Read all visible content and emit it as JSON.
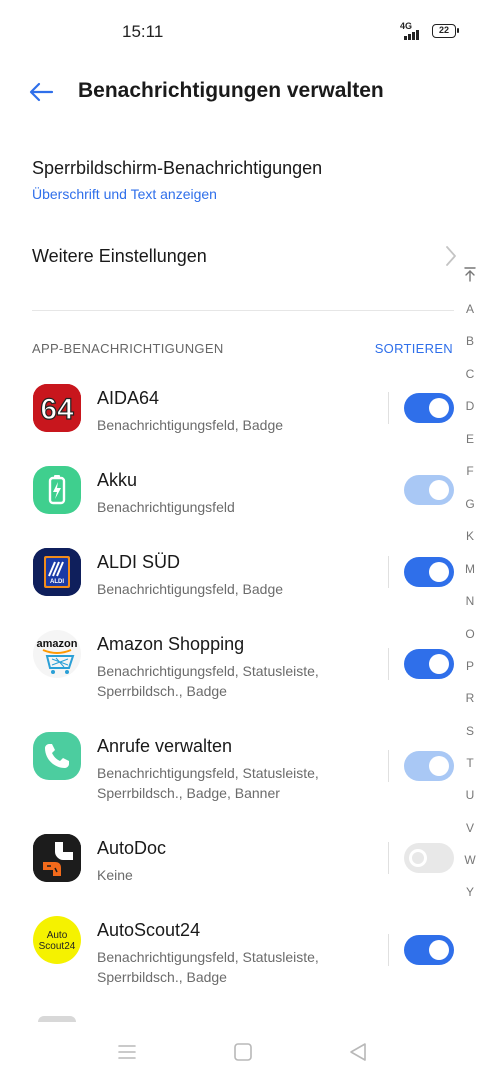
{
  "status_bar": {
    "time": "15:11",
    "network": "4G",
    "battery": "22"
  },
  "header": {
    "title": "Benachrichtigungen verwalten",
    "back_icon": "arrow-left-icon"
  },
  "lockscreen": {
    "title": "Sperrbildschirm-Benachrichtigungen",
    "value": "Überschrift und Text anzeigen"
  },
  "more_settings": {
    "title": "Weitere Einstellungen",
    "icon": "chevron-right-icon"
  },
  "section": {
    "title": "APP-BENACHRICHTIGUNGEN",
    "sort_label": "SORTIEREN"
  },
  "apps": [
    {
      "name": "AIDA64",
      "detail": "Benachrichtigungsfeld, Badge",
      "toggle": "on",
      "icon": "aida64-icon"
    },
    {
      "name": "Akku",
      "detail": "Benachrichtigungsfeld",
      "toggle": "on-disabled",
      "icon": "battery-app-icon"
    },
    {
      "name": "ALDI SÜD",
      "detail": "Benachrichtigungsfeld, Badge",
      "toggle": "on",
      "icon": "aldi-icon"
    },
    {
      "name": "Amazon Shopping",
      "detail": "Benachrichtigungsfeld, Statusleiste, Sperrbildsch., Badge",
      "toggle": "on",
      "icon": "amazon-icon"
    },
    {
      "name": "Anrufe verwalten",
      "detail": "Benachrichtigungsfeld, Statusleiste, Sperrbildsch., Badge, Banner",
      "toggle": "on-disabled",
      "icon": "phone-icon"
    },
    {
      "name": "AutoDoc",
      "detail": "Keine",
      "toggle": "off",
      "icon": "autodoc-icon"
    },
    {
      "name": "AutoScout24",
      "detail": "Benachrichtigungsfeld, Statusleiste, Sperrbildsch., Badge",
      "toggle": "on",
      "icon": "autoscout24-icon"
    }
  ],
  "icon_text": {
    "aida": "64",
    "aldi": "ALDI",
    "amazon": "amazon",
    "autoscout_1": "Auto",
    "autoscout_2": "Scout24"
  },
  "index_letters": [
    "A",
    "B",
    "C",
    "D",
    "E",
    "F",
    "G",
    "K",
    "M",
    "N",
    "O",
    "P",
    "R",
    "S",
    "T",
    "U",
    "V",
    "W",
    "Y"
  ],
  "nav": {
    "menu_icon": "menu-icon",
    "home_icon": "home-square-icon",
    "back_icon": "back-triangle-icon"
  },
  "colors": {
    "accent": "#2f6fea",
    "accent_disabled": "#a9c8f5",
    "toggle_off": "#e8e8e8"
  }
}
